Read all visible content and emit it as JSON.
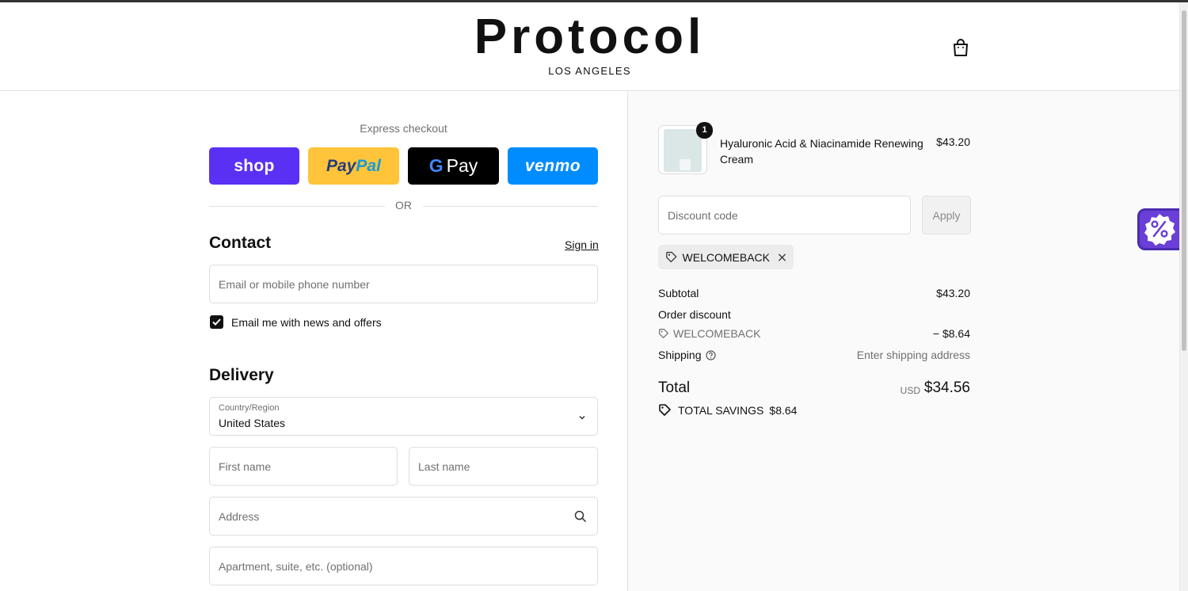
{
  "header": {
    "brand": "Protocol",
    "brand_sub": "LOS ANGELES",
    "cart_icon": "shopping-bag-icon"
  },
  "express": {
    "label": "Express checkout",
    "buttons": {
      "shop": "shop",
      "paypal_a": "Pay",
      "paypal_b": "Pal",
      "gpay_g": "G",
      "gpay_text": "Pay",
      "venmo": "venmo"
    },
    "or": "OR"
  },
  "contact": {
    "title": "Contact",
    "signin": "Sign in",
    "email_placeholder": "Email or mobile phone number",
    "newsletter_label": "Email me with news and offers",
    "newsletter_checked": true
  },
  "delivery": {
    "title": "Delivery",
    "country_label": "Country/Region",
    "country_value": "United States",
    "first_name_placeholder": "First name",
    "last_name_placeholder": "Last name",
    "address_placeholder": "Address",
    "apartment_placeholder": "Apartment, suite, etc. (optional)"
  },
  "summary": {
    "item": {
      "quantity": "1",
      "name": "Hyaluronic Acid & Niacinamide Renewing Cream",
      "price": "$43.20"
    },
    "discount": {
      "placeholder": "Discount code",
      "apply_label": "Apply",
      "applied_code": "WELCOMEBACK"
    },
    "subtotal_label": "Subtotal",
    "subtotal_value": "$43.20",
    "order_discount_label": "Order discount",
    "order_discount_code": "WELCOMEBACK",
    "order_discount_value": "− $8.64",
    "shipping_label": "Shipping",
    "shipping_value": "Enter shipping address",
    "total_label": "Total",
    "total_currency": "USD",
    "total_value": "$34.56",
    "savings_label": "TOTAL SAVINGS",
    "savings_value": "$8.64"
  },
  "colors": {
    "shop": "#5a31f4",
    "paypal": "#ffc439",
    "gpay": "#000000",
    "venmo": "#008cff",
    "promo": "#6a3fd7"
  }
}
